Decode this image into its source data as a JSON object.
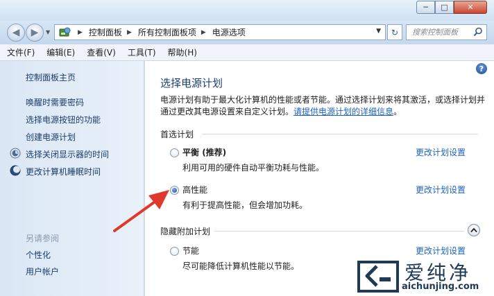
{
  "window": {
    "minimize_glyph": "─",
    "maximize_glyph": "□",
    "close_glyph": "✕"
  },
  "nav": {
    "back_glyph": "◀",
    "forward_glyph": "▶",
    "breadcrumbs": [
      "控制面板",
      "所有控制面板项",
      "电源选项"
    ],
    "search_placeholder": "搜索控制面板",
    "refresh_glyph": "↻"
  },
  "menu": [
    "文件(F)",
    "编辑(E)",
    "查看(V)",
    "工具(T)",
    "帮助(H)"
  ],
  "sidebar": {
    "home": "控制面板主页",
    "links": [
      {
        "label": "唤醒时需要密码",
        "icon": ""
      },
      {
        "label": "选择电源按钮的功能",
        "icon": ""
      },
      {
        "label": "创建电源计划",
        "icon": ""
      },
      {
        "label": "选择关闭显示器的时间",
        "icon": "monitor-icon"
      },
      {
        "label": "更改计算机睡眠时间",
        "icon": "moon-icon"
      }
    ],
    "see_also_label": "另请参阅",
    "see_also": [
      "个性化",
      "用户帐户"
    ]
  },
  "main": {
    "help_glyph": "?",
    "title": "选择电源计划",
    "description": "电源计划有助于最大化计算机的性能或者节能。通过选择计划来将其激活，或选择计划并通过更改其电源设置来自定义计划。",
    "description_link": "请提供电源计划的详细信息",
    "description_end": "。",
    "preferred_label": "首选计划",
    "hidden_label": "隐藏附加计划",
    "plans": [
      {
        "name": "平衡",
        "tag": " (推荐)",
        "desc": "利用可用的硬件自动平衡功耗与性能。",
        "link": "更改计划设置",
        "selected": false
      },
      {
        "name": "高性能",
        "tag": "",
        "desc": "有利于提高性能，但会增加功耗。",
        "link": "更改计划设置",
        "selected": true
      },
      {
        "name": "节能",
        "tag": "",
        "desc": "尽可能降低计算机性能以节能。",
        "link": "更改计划设置",
        "selected": false
      }
    ]
  },
  "watermark": {
    "text": "爱纯净",
    "url": "aichunjing.com"
  },
  "colors": {
    "link": "#1b62bf",
    "title": "#1c3f72",
    "arrow": "#e0382b"
  }
}
